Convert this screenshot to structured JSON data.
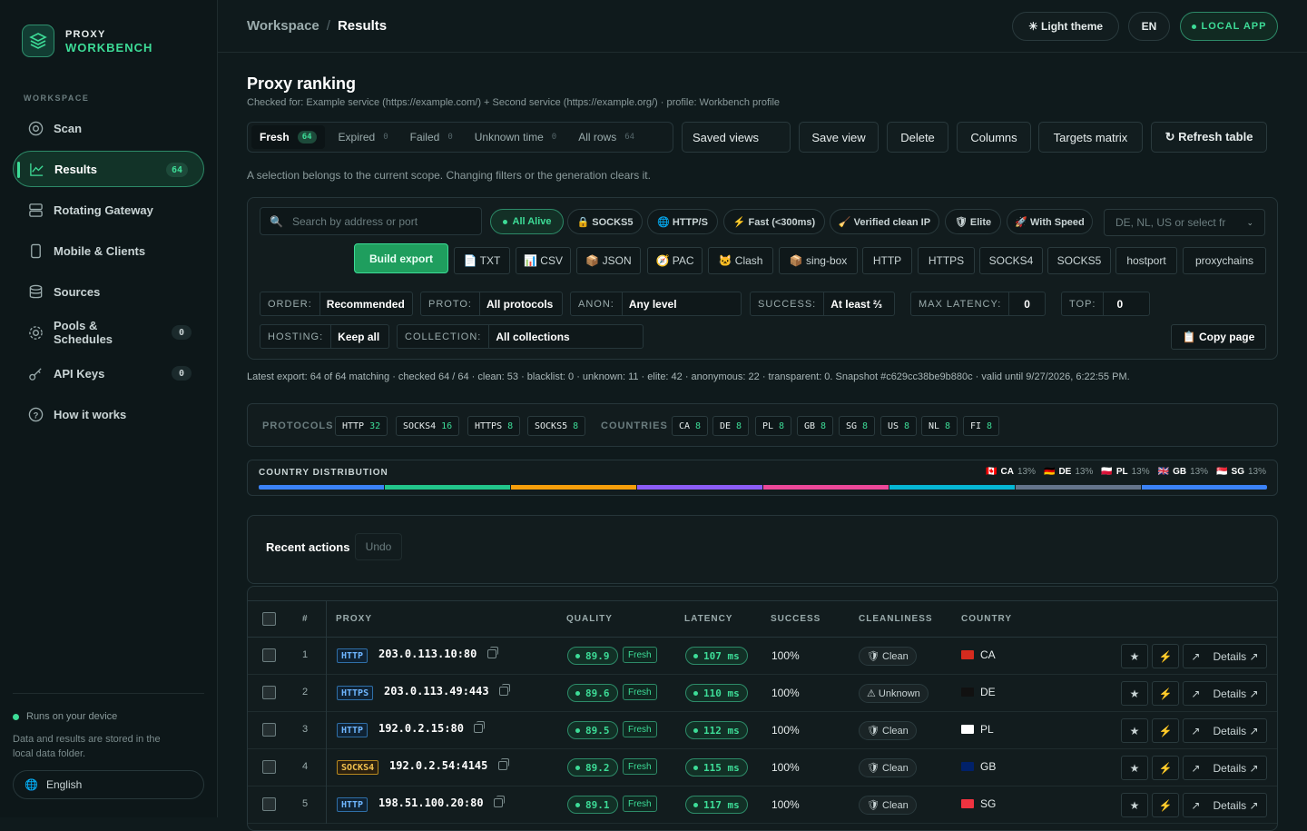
{
  "app": {
    "brand_top": "PROXY",
    "brand_bottom": "WORKBENCH"
  },
  "sidebar": {
    "section": "WORKSPACE",
    "items": [
      {
        "label": "Scan",
        "icon": "target-icon"
      },
      {
        "label": "Results",
        "icon": "chart-icon",
        "badge": "64",
        "active": true
      },
      {
        "label": "Rotating Gateway",
        "icon": "server-icon"
      },
      {
        "label": "Mobile & Clients",
        "icon": "phone-icon"
      },
      {
        "label": "Sources",
        "icon": "database-icon"
      },
      {
        "label": "Pools & Schedules",
        "icon": "gear-icon",
        "badge": "0"
      },
      {
        "label": "API Keys",
        "icon": "key-icon",
        "badge": "0"
      },
      {
        "label": "How it works",
        "icon": "help-icon"
      }
    ],
    "status": "Runs on your device",
    "note": "Data and results are stored in the local data folder.",
    "language": "English"
  },
  "topbar": {
    "crumb_parent": "Workspace",
    "crumb_sep": "/",
    "crumb_current": "Results",
    "theme_btn": "☀ Light theme",
    "lang_btn": "EN",
    "local_btn": "LOCAL APP"
  },
  "page": {
    "title": "Proxy ranking",
    "subtitle": "Checked for: Example service (https://example.com/) + Second service (https://example.org/) · profile: Workbench profile",
    "selection_note": "A selection belongs to the current scope. Changing filters or the generation clears it."
  },
  "tabs": [
    {
      "label": "Fresh",
      "count": "64"
    },
    {
      "label": "Expired",
      "count": "0"
    },
    {
      "label": "Failed",
      "count": "0"
    },
    {
      "label": "Unknown time",
      "count": "0"
    },
    {
      "label": "All rows",
      "count": "64"
    }
  ],
  "actions": {
    "saved_views": "Saved views",
    "save_view": "Save view",
    "delete": "Delete",
    "columns": "Columns",
    "targets": "Targets matrix",
    "refresh": "↻ Refresh table"
  },
  "filters": {
    "search_placeholder": "Search by address or port",
    "chips": [
      "All Alive",
      "🔒 SOCKS5",
      "🌐 HTTP/S",
      "⚡ Fast (<300ms)",
      "🧹 Verified clean IP",
      "🛡 Elite",
      "🚀 With Speed"
    ],
    "country_placeholder": "DE, NL, US or select fr",
    "build_export": "Build export",
    "exports": [
      "📄 TXT",
      "📊 CSV",
      "📦 JSON",
      "🧭 PAC",
      "🐱 Clash",
      "📦 sing-box",
      "HTTP",
      "HTTPS",
      "SOCKS4",
      "SOCKS5",
      "hostport",
      "proxychains"
    ],
    "order": {
      "label": "ORDER:",
      "value": "Recommended"
    },
    "proto": {
      "label": "PROTO:",
      "value": "All protocols"
    },
    "anon": {
      "label": "ANON:",
      "value": "Any level"
    },
    "success": {
      "label": "SUCCESS:",
      "value": "At least ⅔"
    },
    "max_latency": {
      "label": "MAX LATENCY:",
      "value": "0"
    },
    "top": {
      "label": "TOP:",
      "value": "0"
    },
    "hosting": {
      "label": "HOSTING:",
      "value": "Keep all"
    },
    "collection": {
      "label": "COLLECTION:",
      "value": "All collections"
    },
    "copy_page": "📋 Copy page"
  },
  "export_note": "Latest export: 64 of 64 matching · checked 64 / 64 · clean: 53 · blacklist: 0 · unknown: 11 · elite: 42 · anonymous: 22 · transparent: 0. Snapshot #c629cc38be9b880c · valid until 9/27/2026, 6:22:55 PM.",
  "summary": {
    "protocols_label": "PROTOCOLS",
    "protocols": [
      {
        "name": "HTTP",
        "count": "32"
      },
      {
        "name": "SOCKS4",
        "count": "16"
      },
      {
        "name": "HTTPS",
        "count": "8"
      },
      {
        "name": "SOCKS5",
        "count": "8"
      }
    ],
    "countries_label": "COUNTRIES",
    "countries": [
      {
        "name": "CA",
        "count": "8"
      },
      {
        "name": "DE",
        "count": "8"
      },
      {
        "name": "PL",
        "count": "8"
      },
      {
        "name": "GB",
        "count": "8"
      },
      {
        "name": "SG",
        "count": "8"
      },
      {
        "name": "US",
        "count": "8"
      },
      {
        "name": "NL",
        "count": "8"
      },
      {
        "name": "FI",
        "count": "8"
      }
    ]
  },
  "distribution": {
    "title": "COUNTRY DISTRIBUTION",
    "legend": [
      {
        "code": "CA",
        "pct": "13%"
      },
      {
        "code": "DE",
        "pct": "13%"
      },
      {
        "code": "PL",
        "pct": "13%"
      },
      {
        "code": "GB",
        "pct": "13%"
      },
      {
        "code": "SG",
        "pct": "13%"
      }
    ],
    "segments": [
      0.125,
      0.125,
      0.125,
      0.125,
      0.125,
      0.125,
      0.125,
      0.125
    ],
    "colors": [
      "#3b82f6",
      "#22c58b",
      "#f59e0b",
      "#8b5cf6",
      "#ec4899",
      "#06b6d4",
      "#64748b",
      "#3b82f6"
    ]
  },
  "recent": {
    "title": "Recent actions",
    "undo": "Undo"
  },
  "table": {
    "headers": {
      "num": "#",
      "proxy": "PROXY",
      "quality": "QUALITY",
      "latency": "LATENCY",
      "success": "SUCCESS",
      "clean": "CLEANLINESS",
      "country": "COUNTRY"
    },
    "rows": [
      {
        "n": "1",
        "type": "HTTP",
        "addr": "203.0.113.10:80",
        "q": "89.9",
        "fresh": "Fresh",
        "lat": "107 ms",
        "succ": "100%",
        "clean": "🛡 Clean",
        "country": "CA",
        "details": "Details ↗"
      },
      {
        "n": "2",
        "type": "HTTPS",
        "addr": "203.0.113.49:443",
        "q": "89.6",
        "fresh": "Fresh",
        "lat": "110 ms",
        "succ": "100%",
        "clean": "⚠ Unknown",
        "country": "DE",
        "details": "Details ↗"
      },
      {
        "n": "3",
        "type": "HTTP",
        "addr": "192.0.2.15:80",
        "q": "89.5",
        "fresh": "Fresh",
        "lat": "112 ms",
        "succ": "100%",
        "clean": "🛡 Clean",
        "country": "PL",
        "details": "Details ↗"
      },
      {
        "n": "4",
        "type": "SOCKS4",
        "addr": "192.0.2.54:4145",
        "q": "89.2",
        "fresh": "Fresh",
        "lat": "115 ms",
        "succ": "100%",
        "clean": "🛡 Clean",
        "country": "GB",
        "details": "Details ↗"
      },
      {
        "n": "5",
        "type": "HTTP",
        "addr": "198.51.100.20:80",
        "q": "89.1",
        "fresh": "Fresh",
        "lat": "117 ms",
        "succ": "100%",
        "clean": "🛡 Clean",
        "country": "SG",
        "details": "Details ↗"
      }
    ]
  }
}
